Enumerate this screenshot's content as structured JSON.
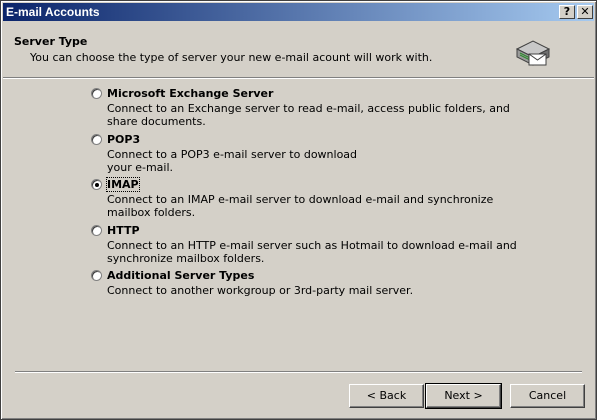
{
  "window": {
    "title": "E-mail Accounts",
    "help_label": "?",
    "close_label": "✕"
  },
  "header": {
    "title": "Server Type",
    "subtitle": "You can choose the type of server your new e-mail acount will work with.",
    "icon": "mail-server-icon"
  },
  "options": [
    {
      "label": "Microsoft Exchange Server",
      "description": [
        "Connect to an Exchange server to read e-mail, access public folders, and",
        "share documents."
      ],
      "selected": false
    },
    {
      "label": "POP3",
      "description": [
        "Connect to a POP3 e-mail server to download",
        "your e-mail."
      ],
      "selected": false
    },
    {
      "label": "IMAP",
      "description": [
        "Connect to an IMAP e-mail server to download e-mail and synchronize",
        "mailbox folders."
      ],
      "selected": true
    },
    {
      "label": "HTTP",
      "description": [
        "Connect to an HTTP e-mail server such as Hotmail to download e-mail and",
        "synchronize mailbox folders."
      ],
      "selected": false
    },
    {
      "label": "Additional Server Types",
      "description": [
        "Connect to another workgroup or 3rd-party mail server."
      ],
      "selected": false
    }
  ],
  "buttons": {
    "back": "< Back",
    "next": "Next >",
    "cancel": "Cancel"
  }
}
